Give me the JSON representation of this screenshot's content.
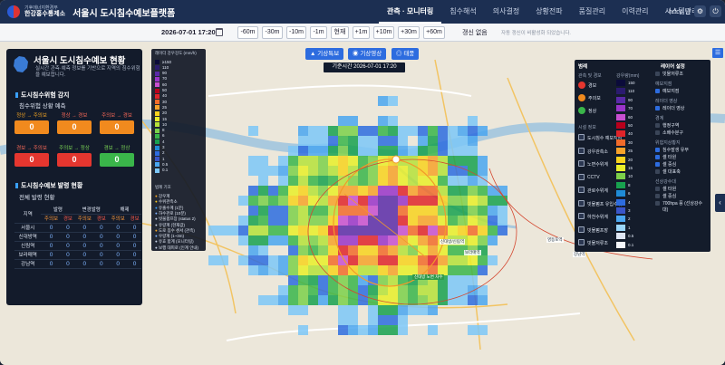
{
  "header": {
    "org_sub": "기후에너지환경부",
    "org_main": "한강홍수통제소",
    "app_title": "서울시 도시침수예보플랫폼",
    "nav": [
      "관측 · 모니터링",
      "침수해석",
      "의사결정",
      "상황전파",
      "품질관리",
      "이력관리",
      "시스템관리"
    ],
    "user": "hrfco 님"
  },
  "timebar": {
    "current_time": "2026-07-01 17:20",
    "steps": [
      "-60m",
      "-30m",
      "-10m",
      "-1m",
      "현재",
      "+1m",
      "+10m",
      "+30m",
      "+60m"
    ],
    "update_status": "갱신 없음",
    "update_note": "자동 갱신이 비활성화 되었습니다."
  },
  "left_panel": {
    "title": "서울시 도시침수예보 현황",
    "desc": "실시간 관측·예측 정보를 기반으로 지역의 침수위험을 예보합니다.",
    "risk_section": "도시침수위험 감지",
    "risk_sub": "침수위험 상황 예측",
    "risk_row1": [
      {
        "label": "정상 → 주의보",
        "value": "0"
      },
      {
        "label": "정상 → 경보",
        "value": "0"
      },
      {
        "label": "주의보 → 경보",
        "value": "0"
      }
    ],
    "risk_row2": [
      {
        "label": "경보 → 주의보",
        "value": "0"
      },
      {
        "label": "주의보 → 정상",
        "value": "0"
      },
      {
        "label": "경보 → 정상",
        "value": "0"
      }
    ],
    "issue_section": "도시침수예보 발령 현황",
    "issue_sub": "전체 발령 현황",
    "table_groups": [
      "지역",
      "발령",
      "변경발령",
      "해제"
    ],
    "table_sub": [
      "주의보",
      "경보",
      "주의보",
      "경보",
      "주의보",
      "경보"
    ],
    "rows": [
      {
        "region": "서울시",
        "v": [
          "0",
          "0",
          "0",
          "0",
          "0",
          "0"
        ]
      },
      {
        "region": "신대방역",
        "v": [
          "0",
          "0",
          "0",
          "0",
          "0",
          "0"
        ]
      },
      {
        "region": "신림역",
        "v": [
          "0",
          "0",
          "0",
          "0",
          "0",
          "0"
        ]
      },
      {
        "region": "보라매역",
        "v": [
          "0",
          "0",
          "0",
          "0",
          "0",
          "0"
        ]
      },
      {
        "region": "강남역",
        "v": [
          "0",
          "0",
          "0",
          "0",
          "0",
          "0"
        ]
      }
    ]
  },
  "map_legend": {
    "title": "레이더 강우강도 (mm/h)",
    "levels": [
      {
        "label": "≥150",
        "color": "#0b0b3a"
      },
      {
        "label": "110",
        "color": "#2b1b6f"
      },
      {
        "label": "90",
        "color": "#5a2aa8"
      },
      {
        "label": "70",
        "color": "#9a34c9"
      },
      {
        "label": "60",
        "color": "#c84fd0"
      },
      {
        "label": "50",
        "color": "#b8001c"
      },
      {
        "label": "40",
        "color": "#e0242a"
      },
      {
        "label": "30",
        "color": "#f26b2a"
      },
      {
        "label": "25",
        "color": "#f7a22a"
      },
      {
        "label": "20",
        "color": "#f8d21e"
      },
      {
        "label": "15",
        "color": "#e9ee29"
      },
      {
        "label": "10",
        "color": "#b6e23a"
      },
      {
        "label": "8",
        "color": "#7cd04a"
      },
      {
        "label": "6",
        "color": "#39b54a"
      },
      {
        "label": "4",
        "color": "#18a14f"
      },
      {
        "label": "3",
        "color": "#1f8bd6"
      },
      {
        "label": "2",
        "color": "#2d6cdf"
      },
      {
        "label": "1",
        "color": "#3a55c8"
      },
      {
        "label": "0.5",
        "color": "#4aa6f0"
      },
      {
        "label": "0.1",
        "color": "#7dc7f7"
      }
    ],
    "symbols_title": "범례 기호",
    "symbols": [
      "강우계",
      "수위관측소",
      "유출수계 (1분)",
      "하수관로 (10분)",
      "빗물펌프장 (status 2)",
      "유량계 (현재값)",
      "도로 침수 센서 (관측)",
      "우량계 (1~3m)",
      "유효 합계 (모니터링)",
      "보행 대피로 (인계 안내)"
    ]
  },
  "map_controls": {
    "buttons": [
      "기상특보",
      "기상영상",
      "태풍"
    ],
    "base_time": "기준시간 2026-07-01 17:20"
  },
  "right_panel": {
    "legend_title": "범례",
    "layer_title": "레이어 설정",
    "col_symbol": "관측 및 경보",
    "col_rain": "강우량(mm)",
    "symbols": [
      "경보",
      "주의보",
      "정상"
    ],
    "infra_title": "시설 정보",
    "infra": [
      "도시침수 예보지점",
      "강우관측소",
      "노면수위계",
      "CCTV",
      "관로수위계",
      "빗물펌프 유입수위",
      "하천수위계",
      "빗물펌프장",
      "빗물저류조"
    ],
    "rain_levels": [
      {
        "label": "150",
        "color": "#0b0b3a"
      },
      {
        "label": "110",
        "color": "#2b1b6f"
      },
      {
        "label": "90",
        "color": "#5a2aa8"
      },
      {
        "label": "70",
        "color": "#9a34c9"
      },
      {
        "label": "60",
        "color": "#c84fd0"
      },
      {
        "label": "50",
        "color": "#b8001c"
      },
      {
        "label": "40",
        "color": "#e0242a"
      },
      {
        "label": "30",
        "color": "#f26b2a"
      },
      {
        "label": "25",
        "color": "#f7a22a"
      },
      {
        "label": "20",
        "color": "#f8d21e"
      },
      {
        "label": "15",
        "color": "#e9ee29"
      },
      {
        "label": "10",
        "color": "#7cd04a"
      },
      {
        "label": "8",
        "color": "#18a14f"
      },
      {
        "label": "6",
        "color": "#1f8bd6"
      },
      {
        "label": "4",
        "color": "#2d6cdf"
      },
      {
        "label": "3",
        "color": "#3a55c8"
      },
      {
        "label": "2",
        "color": "#4aa6f0"
      },
      {
        "label": "1",
        "color": "#9ad6f9"
      },
      {
        "label": "0.5",
        "color": "#dfe6f3"
      },
      {
        "label": "0.1",
        "color": "#f4f6fa"
      }
    ],
    "layers": [
      {
        "group": "",
        "items": [
          {
            "label": "빗물저류조",
            "on": false
          }
        ]
      },
      {
        "group": "예보지점",
        "items": [
          {
            "label": "예보지점",
            "on": true
          }
        ]
      },
      {
        "group": "레이더 영상",
        "items": [
          {
            "label": "레이더 영상",
            "on": true
          }
        ]
      },
      {
        "group": "경계",
        "items": [
          {
            "label": "행정구역",
            "on": false
          },
          {
            "label": "소배수분구",
            "on": false
          }
        ]
      },
      {
        "group": "위험지상황지",
        "items": [
          {
            "label": "침수발생 유무",
            "on": true
          },
          {
            "label": "셀 타원",
            "on": true
          },
          {
            "label": "셀 중심",
            "on": true
          },
          {
            "label": "셀 대표축",
            "on": false
          }
        ]
      },
      {
        "group": "선상강수대",
        "items": [
          {
            "label": "셀 타원",
            "on": false
          },
          {
            "label": "셀 중심",
            "on": false
          },
          {
            "label": "700hpa 풍 (선상강수대)",
            "on": false
          }
        ]
      }
    ]
  },
  "map_labels": [
    "신대방/신림역",
    "보라매역",
    "영등포역",
    "강남역",
    "신대방 노변 차수"
  ]
}
